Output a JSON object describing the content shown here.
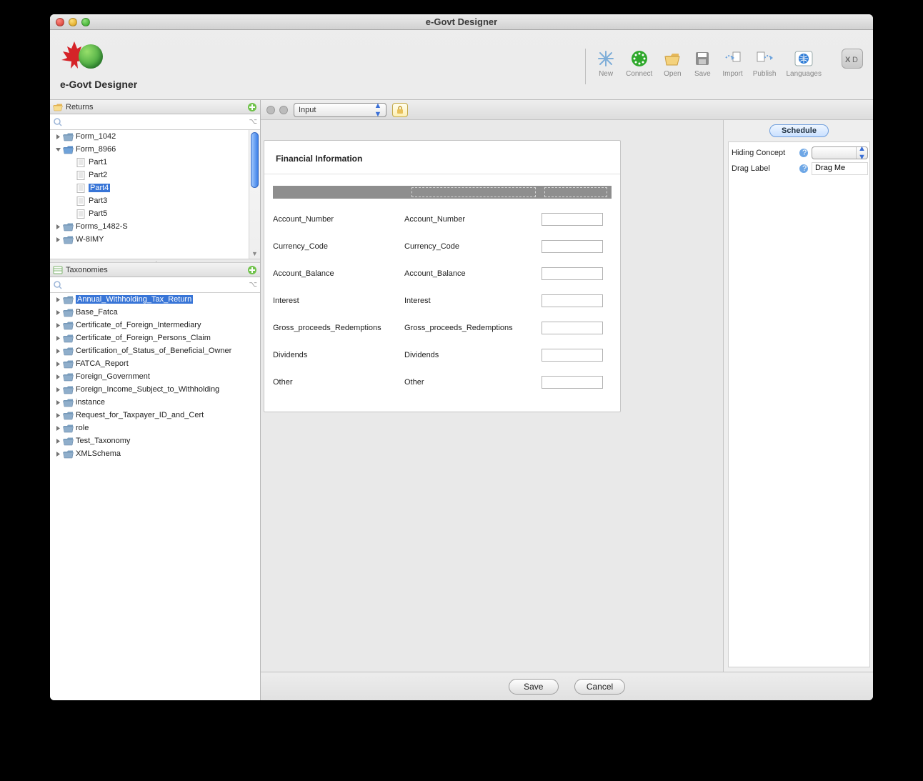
{
  "window": {
    "title": "e-Govt Designer"
  },
  "brand": {
    "name": "e-Govt Designer"
  },
  "toolbar": {
    "new": "New",
    "connect": "Connect",
    "open": "Open",
    "save": "Save",
    "import": "Import",
    "publish": "Publish",
    "languages": "Languages"
  },
  "panels": {
    "returns": {
      "title": "Returns",
      "tree": [
        {
          "label": "Form_1042",
          "type": "folder",
          "depth": 0,
          "expanded": false
        },
        {
          "label": "Form_8966",
          "type": "folder",
          "depth": 0,
          "expanded": true
        },
        {
          "label": "Part1",
          "type": "file",
          "depth": 1
        },
        {
          "label": "Part2",
          "type": "file",
          "depth": 1
        },
        {
          "label": "Part4",
          "type": "file",
          "depth": 1,
          "selected": true
        },
        {
          "label": "Part3",
          "type": "file",
          "depth": 1
        },
        {
          "label": "Part5",
          "type": "file",
          "depth": 1
        },
        {
          "label": "Forms_1482-S",
          "type": "folder",
          "depth": 0,
          "expanded": false
        },
        {
          "label": "W-8IMY",
          "type": "folder",
          "depth": 0,
          "expanded": false
        }
      ]
    },
    "taxonomies": {
      "title": "Taxonomies",
      "tree": [
        {
          "label": "Annual_Withholding_Tax_Return",
          "selected": true
        },
        {
          "label": "Base_Fatca"
        },
        {
          "label": "Certificate_of_Foreign_Intermediary"
        },
        {
          "label": "Certificate_of_Foreign_Persons_Claim"
        },
        {
          "label": "Certification_of_Status_of_Beneficial_Owner"
        },
        {
          "label": "FATCA_Report"
        },
        {
          "label": "Foreign_Government"
        },
        {
          "label": "Foreign_Income_Subject_to_Withholding"
        },
        {
          "label": "instance"
        },
        {
          "label": "Request_for_Taxpayer_ID_and_Cert"
        },
        {
          "label": "role"
        },
        {
          "label": "Test_Taxonomy"
        },
        {
          "label": "XMLSchema"
        }
      ]
    }
  },
  "canvas": {
    "mode_select": "Input",
    "form_title": "Financial Information",
    "fields": [
      {
        "label": "Account_Number",
        "desc": "Account_Number"
      },
      {
        "label": "Currency_Code",
        "desc": "Currency_Code"
      },
      {
        "label": "Account_Balance",
        "desc": "Account_Balance"
      },
      {
        "label": "Interest",
        "desc": "Interest"
      },
      {
        "label": "Gross_proceeds_Redemptions",
        "desc": "Gross_proceeds_Redemptions"
      },
      {
        "label": "Dividends",
        "desc": "Dividends"
      },
      {
        "label": "Other",
        "desc": "Other"
      }
    ]
  },
  "inspector": {
    "tab": "Schedule",
    "rows": {
      "hiding_concept": "Hiding Concept",
      "drag_label": "Drag Label",
      "drag_value": "Drag Me"
    }
  },
  "footer": {
    "save": "Save",
    "cancel": "Cancel"
  }
}
